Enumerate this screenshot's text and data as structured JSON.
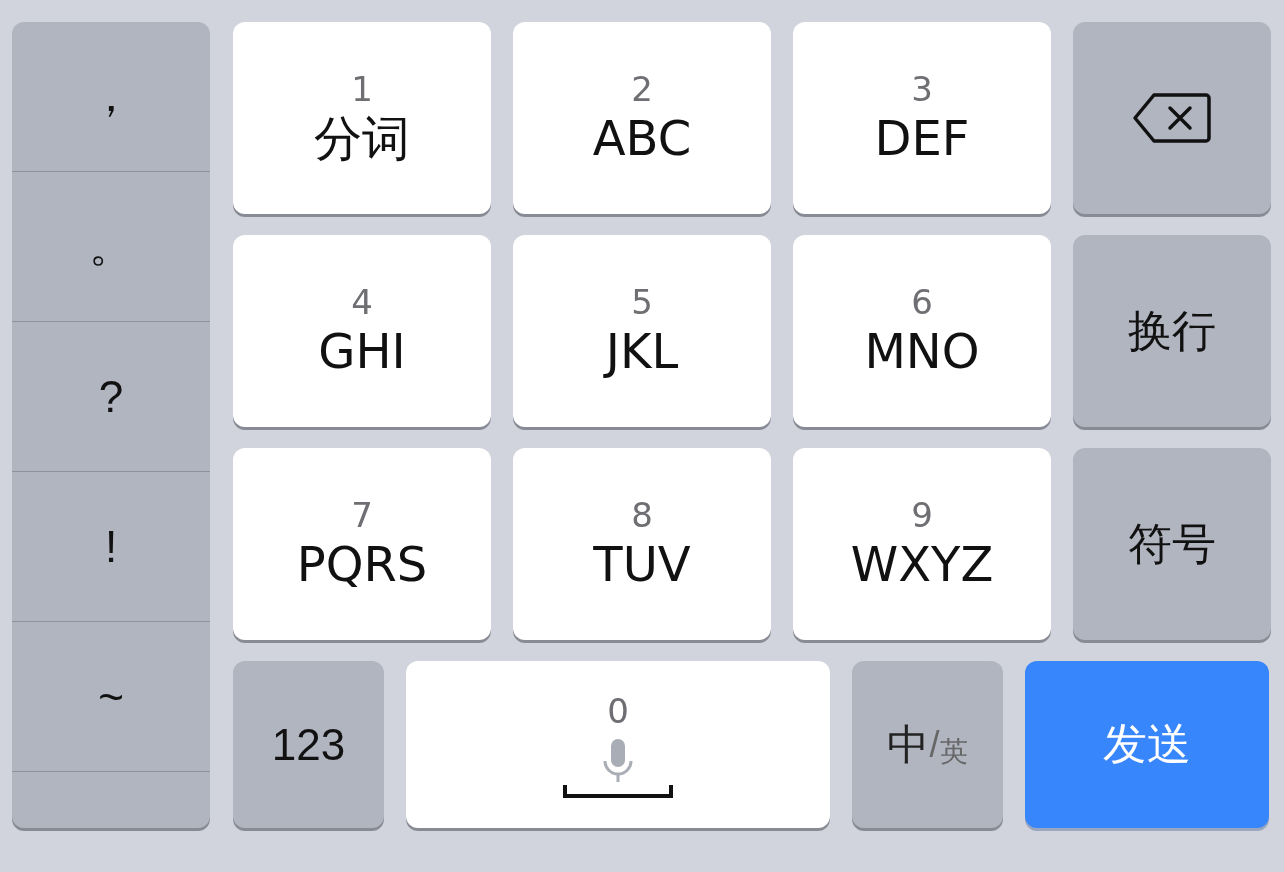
{
  "punctuation": [
    {
      "label": "，"
    },
    {
      "label": "。"
    },
    {
      "label": "?"
    },
    {
      "label": "!"
    },
    {
      "label": "~"
    }
  ],
  "key_rows": [
    {
      "keys": [
        {
          "digit": "1",
          "letters": "分词"
        },
        {
          "digit": "2",
          "letters": "ABC"
        },
        {
          "digit": "3",
          "letters": "DEF"
        }
      ],
      "side": {
        "kind": "delete"
      }
    },
    {
      "keys": [
        {
          "digit": "4",
          "letters": "GHI"
        },
        {
          "digit": "5",
          "letters": "JKL"
        },
        {
          "digit": "6",
          "letters": "MNO"
        }
      ],
      "side": {
        "kind": "text",
        "label": "换行"
      }
    },
    {
      "keys": [
        {
          "digit": "7",
          "letters": "PQRS"
        },
        {
          "digit": "8",
          "letters": "TUV"
        },
        {
          "digit": "9",
          "letters": "WXYZ"
        }
      ],
      "side": {
        "kind": "text",
        "label": "符号"
      }
    }
  ],
  "bottom": {
    "numbers": "123",
    "space_digit": "0",
    "language": {
      "primary": "中",
      "separator": "/",
      "secondary": "英"
    },
    "send": "发送"
  }
}
